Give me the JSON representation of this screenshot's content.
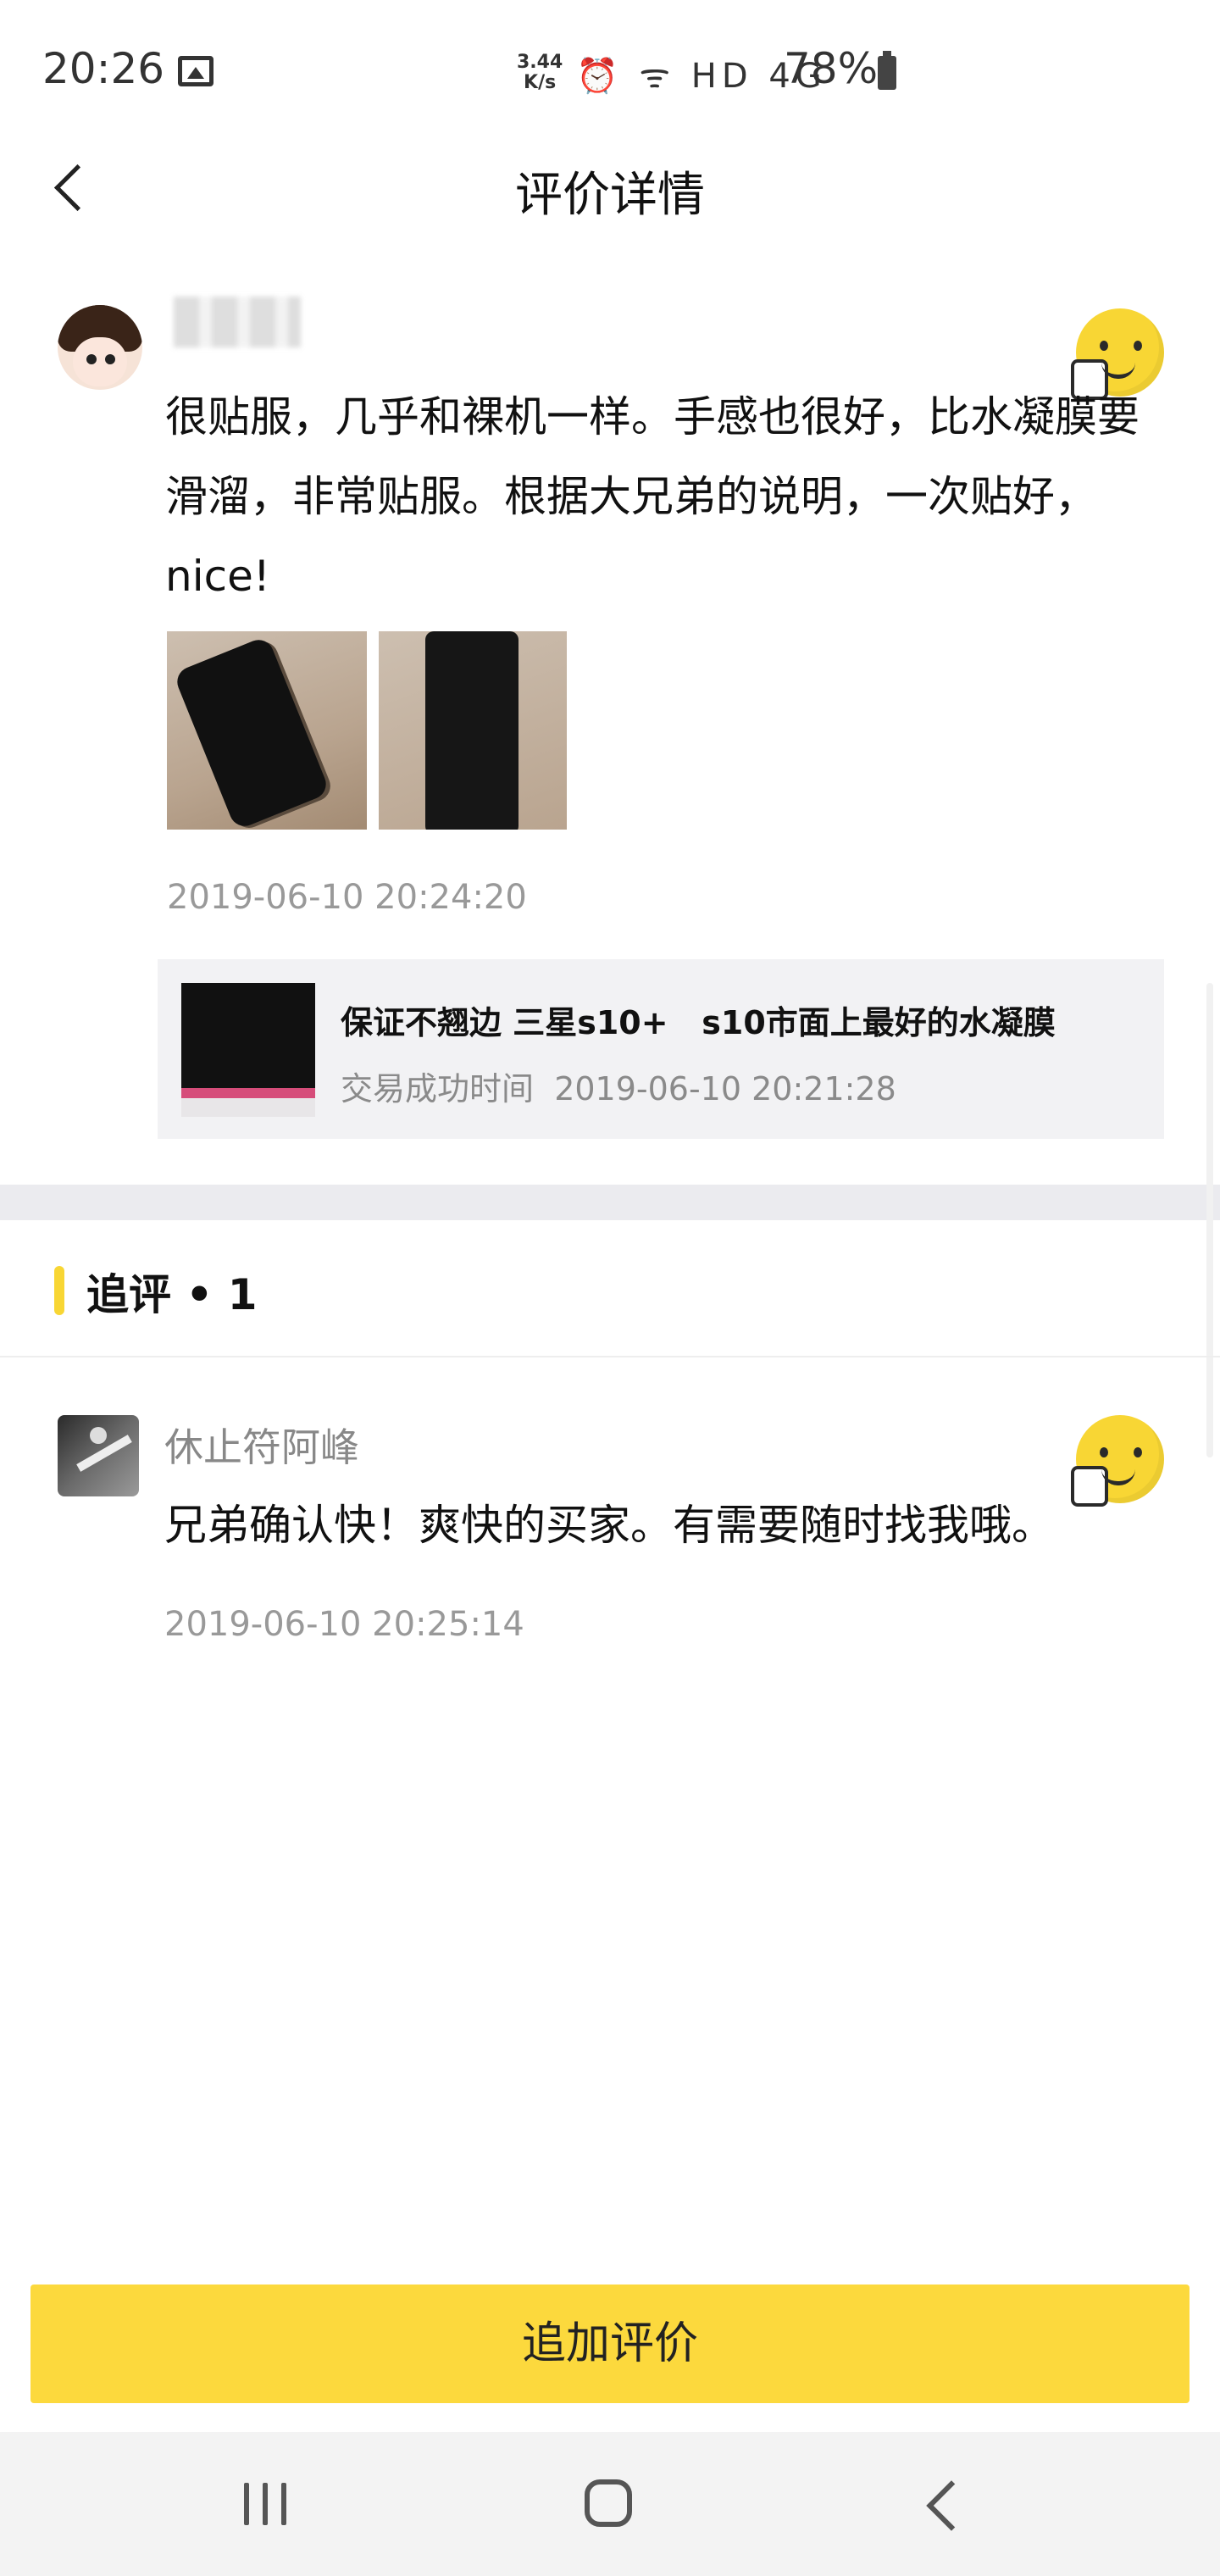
{
  "status_bar": {
    "time": "20:26",
    "net_speed_value": "3.44",
    "net_speed_unit": "K/s",
    "icons": [
      "image-icon",
      "alarm-icon",
      "wifi-icon",
      "hd-icon",
      "4g-signal-icon",
      "battery-icon"
    ],
    "icons_text": "⏰ ᯤ HD 4G",
    "battery": "78%"
  },
  "header": {
    "title": "评价详情"
  },
  "review": {
    "text": "很贴服，几乎和裸机一样。手感也很好，比水凝膜要滑溜，非常贴服。根据大兄弟的说明，一次贴好，nice!",
    "time": "2019-06-10 20:24:20",
    "rating_icon": "thumbs-up-smiley-icon"
  },
  "product": {
    "title": "保证不翘边 三星s10+   s10市面上最好的水凝膜",
    "meta_label": "交易成功时间",
    "meta_time": "2019-06-10 20:21:28"
  },
  "followup": {
    "title": "追评 • 1",
    "user_name": "休止符阿峰",
    "text": "兄弟确认快！爽快的买家。有需要随时找我哦。",
    "time": "2019-06-10 20:25:14"
  },
  "actions": {
    "add_review": "追加评价"
  },
  "colors": {
    "accent": "#fcd93d",
    "divider": "#ebebef",
    "card_bg": "#f2f2f4"
  }
}
